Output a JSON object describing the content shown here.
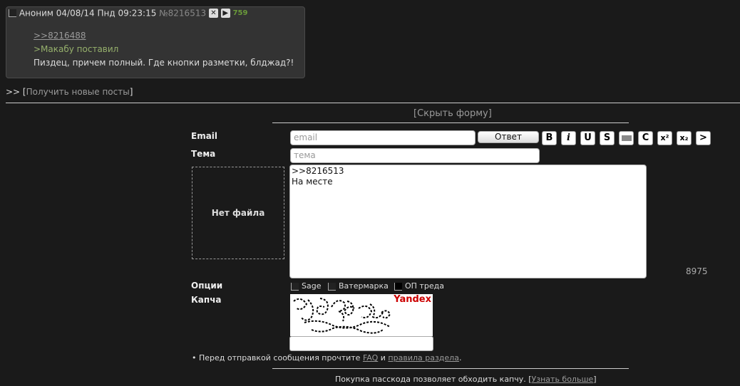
{
  "post": {
    "author": "Аноним",
    "datetime": "04/08/14 Пнд 09:23:15",
    "number": "№8216513",
    "counter": "759",
    "reply_link": ">>8216488",
    "quote": ">Макабу поставил",
    "text": "Пиздец, причем полный. Где кнопки разметки, блджад?!"
  },
  "thread_nav": {
    "prefix": ">> [",
    "link": "Получить новые посты",
    "suffix": "]"
  },
  "form": {
    "hide_open": "[",
    "hide_link": "Скрыть форму",
    "hide_close": "]",
    "email_label": "Email",
    "email_placeholder": "email",
    "subject_label": "Тема",
    "subject_placeholder": "тема",
    "submit_label": "Ответ",
    "no_file": "Нет файла",
    "message_line1": ">>8216513",
    "message_line2": "На месте",
    "char_counter": "8975",
    "options_label": "Опции",
    "opt_sage": "Sage",
    "opt_watermark": "Ватермарка",
    "opt_op": "ОП треда",
    "captcha_label": "Капча",
    "captcha_brand": "Yandex",
    "rules_prefix": "• Перед отправкой сообщения прочтите",
    "rules_faq": "FAQ",
    "rules_and": "и",
    "rules_link": "правила раздела",
    "rules_dot": ".",
    "pass_text": "Покупка пасскода позволяет обходить капчу. [",
    "pass_link": "Узнать больше",
    "pass_close": "]"
  },
  "markup_buttons": {
    "bold": "B",
    "italic": "i",
    "underline": "U",
    "strike": "S",
    "spoiler": "",
    "code": "C",
    "sup": "x²",
    "sub": "x₂",
    "quote": ">"
  }
}
